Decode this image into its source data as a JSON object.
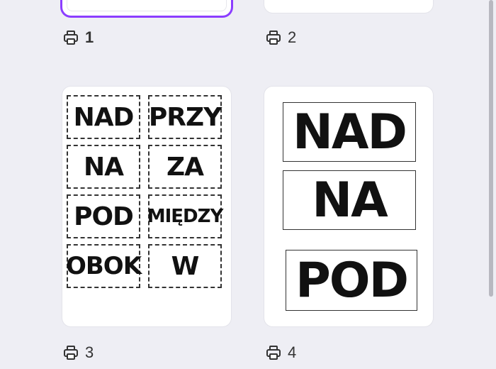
{
  "pages": [
    {
      "number": "1",
      "selected": true
    },
    {
      "number": "2",
      "selected": false
    },
    {
      "number": "3",
      "selected": false
    },
    {
      "number": "4",
      "selected": false
    }
  ],
  "page3_tiles": [
    "NAD",
    "PRZY",
    "NA",
    "ZA",
    "POD",
    "MIĘDZY",
    "OBOK",
    "W"
  ],
  "page4_tiles": [
    "NAD",
    "NA",
    "POD"
  ],
  "icons": {
    "page_label_icon": "print-icon"
  },
  "colors": {
    "selection": "#8b3dff",
    "background": "#eeeef4",
    "card": "#ffffff"
  }
}
